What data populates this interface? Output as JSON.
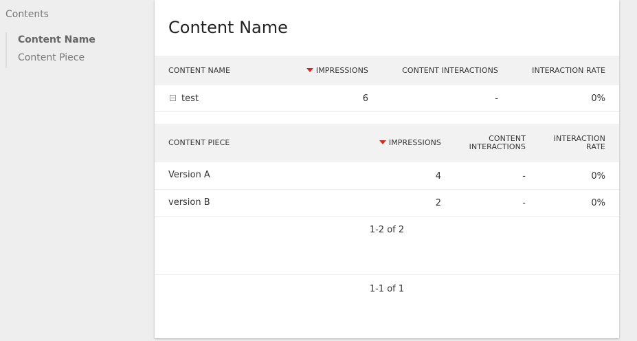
{
  "sidebar": {
    "heading": "Contents",
    "items": [
      {
        "label": "Content Name",
        "active": true
      },
      {
        "label": "Content Piece",
        "active": false
      }
    ]
  },
  "main": {
    "title": "Content Name",
    "outer_table": {
      "columns": [
        "CONTENT NAME",
        "IMPRESSIONS",
        "CONTENT INTERACTIONS",
        "INTERACTION RATE"
      ],
      "sorted_column": "IMPRESSIONS",
      "rows": [
        {
          "name": "test",
          "impressions": "6",
          "interactions": "-",
          "rate": "0%"
        }
      ],
      "pagination": "1-1 of 1"
    },
    "inner_table": {
      "columns": [
        "CONTENT PIECE",
        "IMPRESSIONS",
        "CONTENT",
        "INTERACTIONS",
        "INTERACTION",
        "RATE"
      ],
      "sorted_column": "IMPRESSIONS",
      "rows": [
        {
          "name": "Version A",
          "impressions": "4",
          "interactions": "-",
          "rate": "0%"
        },
        {
          "name": "version B",
          "impressions": "2",
          "interactions": "-",
          "rate": "0%"
        }
      ],
      "pagination": "1-2 of 2"
    }
  },
  "colors": {
    "sort_arrow": "#d4291f",
    "header_bg": "#f2f2f2",
    "page_bg": "#eeeeee"
  }
}
